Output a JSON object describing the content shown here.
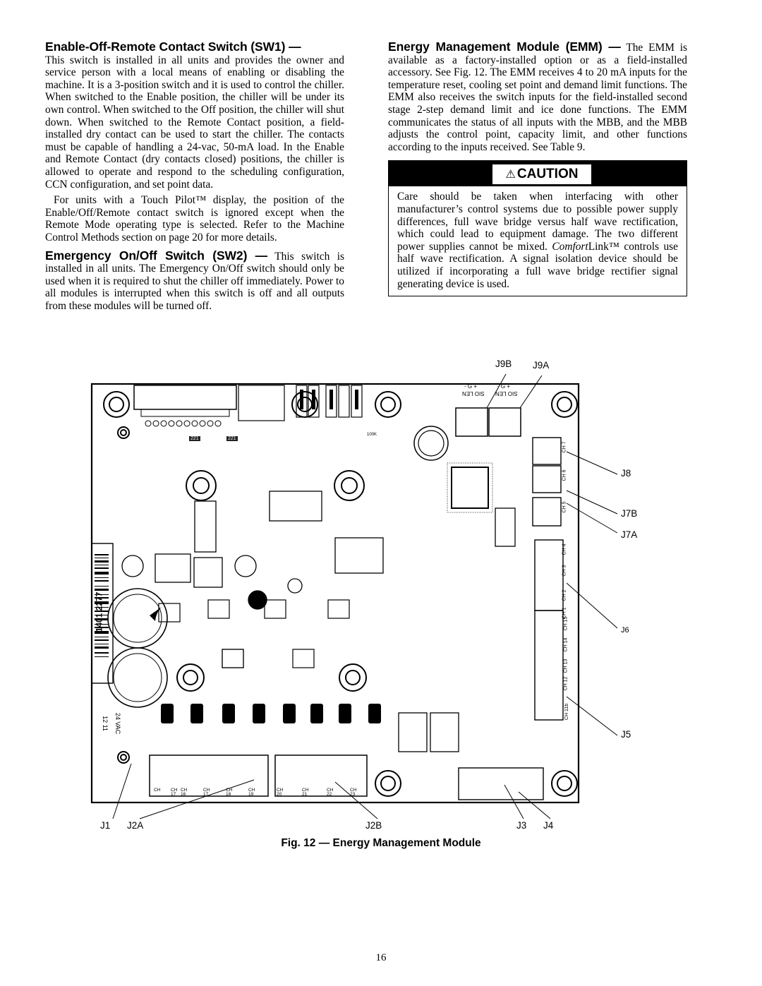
{
  "left_column": {
    "sw1": {
      "heading": "Enable-Off-Remote Contact Switch (SW1) —",
      "body": "This switch is installed in all units and provides the owner and service person with a local means of enabling or disabling the machine. It is a 3-position switch and it is used to control the chiller. When switched to the Enable position, the chiller will be under its own control. When switched to the Off position, the chiller will shut down. When switched to the Remote Contact position, a field-installed dry contact can be used to start the chiller. The contacts must be capable of handling a 24-vac, 50-mA load. In the Enable and Remote Contact (dry contacts closed) positions, the chiller is allowed to operate and respond to the scheduling configuration, CCN configuration, and set point data.",
      "note": "For units with a Touch Pilot™ display, the position of the Enable/Off/Remote contact switch is ignored except when the Remote Mode operating type is selected. Refer to the Machine Control Methods section on page 20 for more details."
    },
    "sw2": {
      "heading": "Emergency On/Off Switch (SW2) —",
      "body": " This switch is installed in all units. The Emergency On/Off switch should only be used when it is required to shut the chiller off immediately. Power to all modules is interrupted when this switch is off and all outputs from these modules will be turned off."
    }
  },
  "right_column": {
    "emm": {
      "heading": "Energy Management Module (EMM) —",
      "body": " The EMM is available as a factory-installed option or as a field-installed accessory. See Fig. 12. The EMM receives 4 to 20 mA inputs for the temperature reset, cooling set point and demand limit functions. The EMM also receives the switch inputs for the field-installed second stage 2-step demand limit and ice done functions. The EMM communicates the status of all inputs with the MBB, and the MBB adjusts the control point, capacity limit, and other functions according to the inputs received. See Table 9."
    },
    "caution": {
      "icon": "warning-triangle-icon",
      "label": "CAUTION",
      "body_part1": "Care should be taken when interfacing with other manufacturer’s control systems due to possible power supply differences, full wave bridge versus half wave rectification, which could lead to equipment damage. The two different power supplies cannot be mixed. ",
      "body_italic": "Comfort",
      "body_part2": "Link™ controls use half wave rectification. A signal isolation device should be utilized if incorporating a full wave bridge rectifier signal generating device is used."
    }
  },
  "figure": {
    "caption": "Fig. 12 — Energy Management Module",
    "callouts": {
      "j9b": "J9B",
      "j9a": "J9A",
      "j8": "J8",
      "j7b": "J7B",
      "j7a": "J7A",
      "j6": "J6",
      "j5": "J5",
      "j1": "J1",
      "j2a": "J2A",
      "j2b": "J2B",
      "j3": "J3",
      "j4": "J4"
    },
    "board_labels": {
      "sio_len": "SIO LEN",
      "sio_pins": "- G +",
      "power": "24 VAC",
      "power_pins": "12  11",
      "barcode": "1401 2277",
      "resistor_221": "221",
      "resistor_100k": "100K",
      "ch_prefix": "CH",
      "right_channels": [
        "7",
        "6",
        "5",
        "4",
        "3",
        "2",
        "1",
        "15",
        "14",
        "13",
        "12",
        "11b"
      ],
      "bottom_channels": [
        "",
        "17",
        "16",
        "17",
        "18",
        "19",
        "20",
        "21",
        "22",
        "23"
      ]
    }
  },
  "page_number": "16"
}
